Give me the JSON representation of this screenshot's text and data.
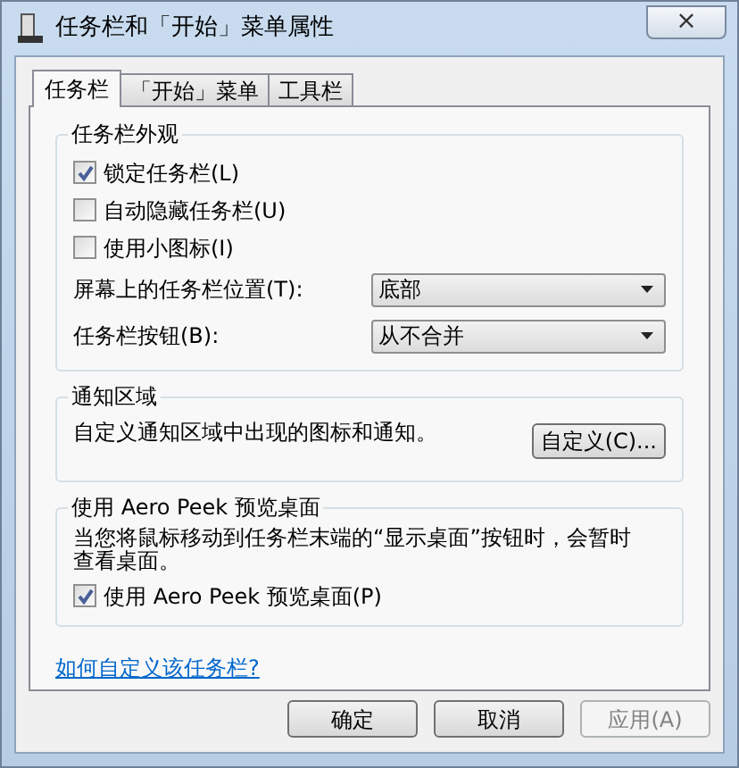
{
  "window": {
    "title": "任务栏和「开始」菜单属性",
    "close": "×"
  },
  "tabs": [
    {
      "label": "任务栏",
      "selected": true
    },
    {
      "label": "「开始」菜单",
      "selected": false
    },
    {
      "label": "工具栏",
      "selected": false
    }
  ],
  "appearance": {
    "title": "任务栏外观",
    "options": [
      {
        "label": "锁定任务栏(L)",
        "checked": true
      },
      {
        "label": "自动隐藏任务栏(U)",
        "checked": false
      },
      {
        "label": "使用小图标(I)",
        "checked": false
      }
    ],
    "dropdowns": [
      {
        "label": "屏幕上的任务栏位置(T):",
        "value": "底部"
      },
      {
        "label": "任务栏按钮(B):",
        "value": "从不合并"
      }
    ]
  },
  "notification": {
    "title": "通知区域",
    "text": "自定义通知区域中出现的图标和通知。",
    "button": "自定义(C)..."
  },
  "aero_peek": {
    "title": "使用 Aero Peek 预览桌面",
    "text": "当您将鼠标移动到任务栏末端的“显示桌面”按钮时，会暂时查看桌面。",
    "option": {
      "label": "使用 Aero Peek 预览桌面(P)",
      "checked": true
    }
  },
  "help_link": "如何自定义该任务栏?",
  "buttons": [
    {
      "label": "确定",
      "disabled": false
    },
    {
      "label": "取消",
      "disabled": false
    },
    {
      "label": "应用(A)",
      "disabled": true
    }
  ]
}
